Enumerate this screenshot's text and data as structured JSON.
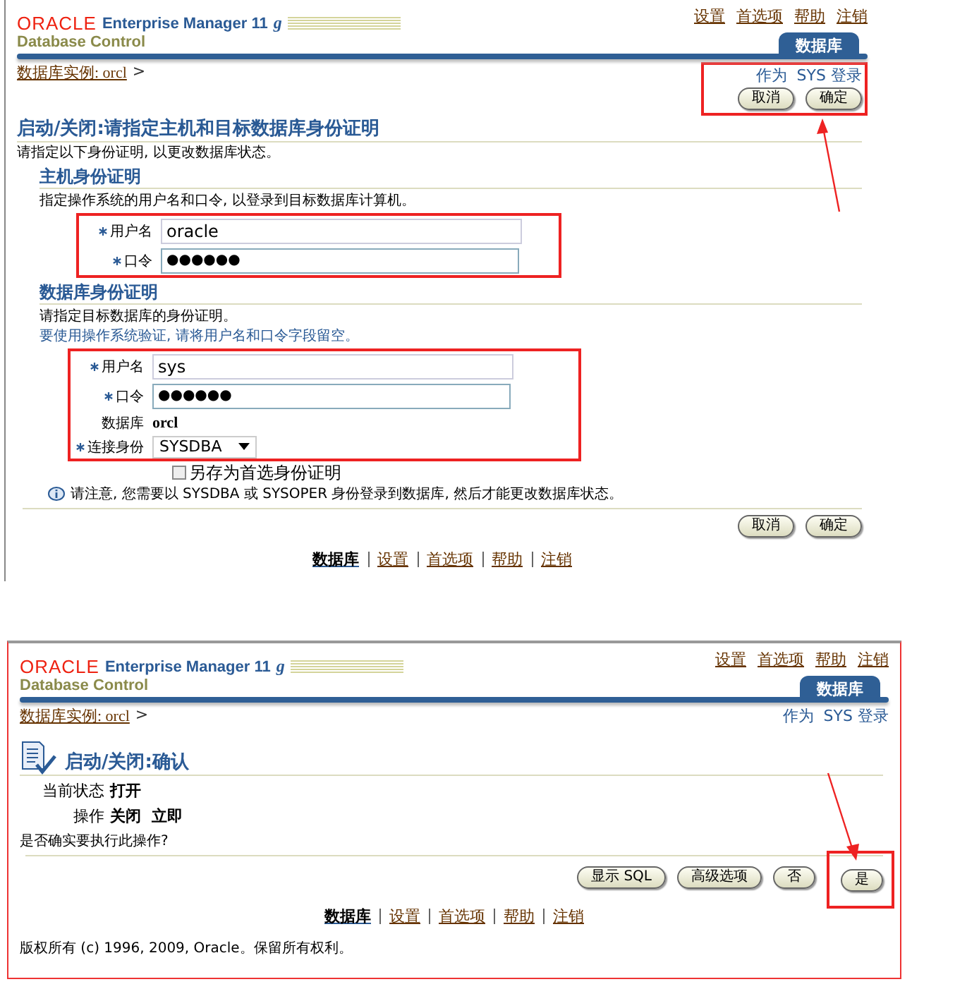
{
  "credentials_page": {
    "header": {
      "brand": "ORACLE",
      "product": "Enterprise Manager 11",
      "product_suffix": "g",
      "subtitle": "Database Control",
      "global_links": [
        "设置",
        "首选项",
        "帮助",
        "注销"
      ],
      "tab": "数据库"
    },
    "breadcrumb": "数据库实例: orcl",
    "breadcrumb_separator": ">",
    "login_info": "作为  SYS 登录",
    "top_buttons": [
      "取消",
      "确定"
    ],
    "title": "启动/关闭:请指定主机和目标数据库身份证明",
    "intro": "请指定以下身份证明, 以更改数据库状态。",
    "sections": [
      {
        "heading": "主机身份证明",
        "description": "指定操作系统的用户名和口令, 以登录到目标数据库计算机。",
        "fields": [
          {
            "kind": "text",
            "label": "用户名",
            "required": true,
            "value": "oracle"
          },
          {
            "kind": "password",
            "label": "口令",
            "required": true,
            "value": "●●●●●●"
          }
        ]
      },
      {
        "heading": "数据库身份证明",
        "description": "请指定目标数据库的身份证明。",
        "hint": "要使用操作系统验证, 请将用户名和口令字段留空。",
        "fields": [
          {
            "kind": "text",
            "label": "用户名",
            "required": true,
            "value": "sys"
          },
          {
            "kind": "password",
            "label": "口令",
            "required": true,
            "value": "●●●●●●"
          },
          {
            "kind": "static",
            "label": "数据库",
            "required": false,
            "value": "orcl"
          },
          {
            "kind": "select",
            "label": "连接身份",
            "required": true,
            "value": "SYSDBA"
          }
        ],
        "checkbox": {
          "label": "另存为首选身份证明",
          "checked": false
        }
      }
    ],
    "note": "请注意, 您需要以  SYSDBA 或  SYSOPER 身份登录到数据库, 然后才能更改数据库状态。",
    "bottom_buttons": [
      "取消",
      "确定"
    ],
    "footer_links": [
      {
        "label": "数据库",
        "selected": true
      },
      {
        "label": "设置",
        "selected": false
      },
      {
        "label": "首选项",
        "selected": false
      },
      {
        "label": "帮助",
        "selected": false
      },
      {
        "label": "注销",
        "selected": false
      }
    ]
  },
  "confirm_page": {
    "header": {
      "brand": "ORACLE",
      "product": "Enterprise Manager 11",
      "product_suffix": "g",
      "subtitle": "Database Control",
      "global_links": [
        "设置",
        "首选项",
        "帮助",
        "注销"
      ],
      "tab": "数据库"
    },
    "breadcrumb": "数据库实例: orcl",
    "breadcrumb_separator": ">",
    "login_info": "作为  SYS 登录",
    "title": "启动/关闭:确认",
    "details": [
      {
        "label": "当前状态",
        "value": "打开"
      },
      {
        "label": "操作",
        "value": "关闭  立即"
      }
    ],
    "question": "是否确实要执行此操作?",
    "buttons": [
      "显示 SQL",
      "高级选项",
      "否",
      "是"
    ],
    "footer_links": [
      {
        "label": "数据库",
        "selected": true
      },
      {
        "label": "设置",
        "selected": false
      },
      {
        "label": "首选项",
        "selected": false
      },
      {
        "label": "帮助",
        "selected": false
      },
      {
        "label": "注销",
        "selected": false
      }
    ],
    "copyright": "版权所有 (c) 1996, 2009, Oracle。保留所有权利。"
  }
}
